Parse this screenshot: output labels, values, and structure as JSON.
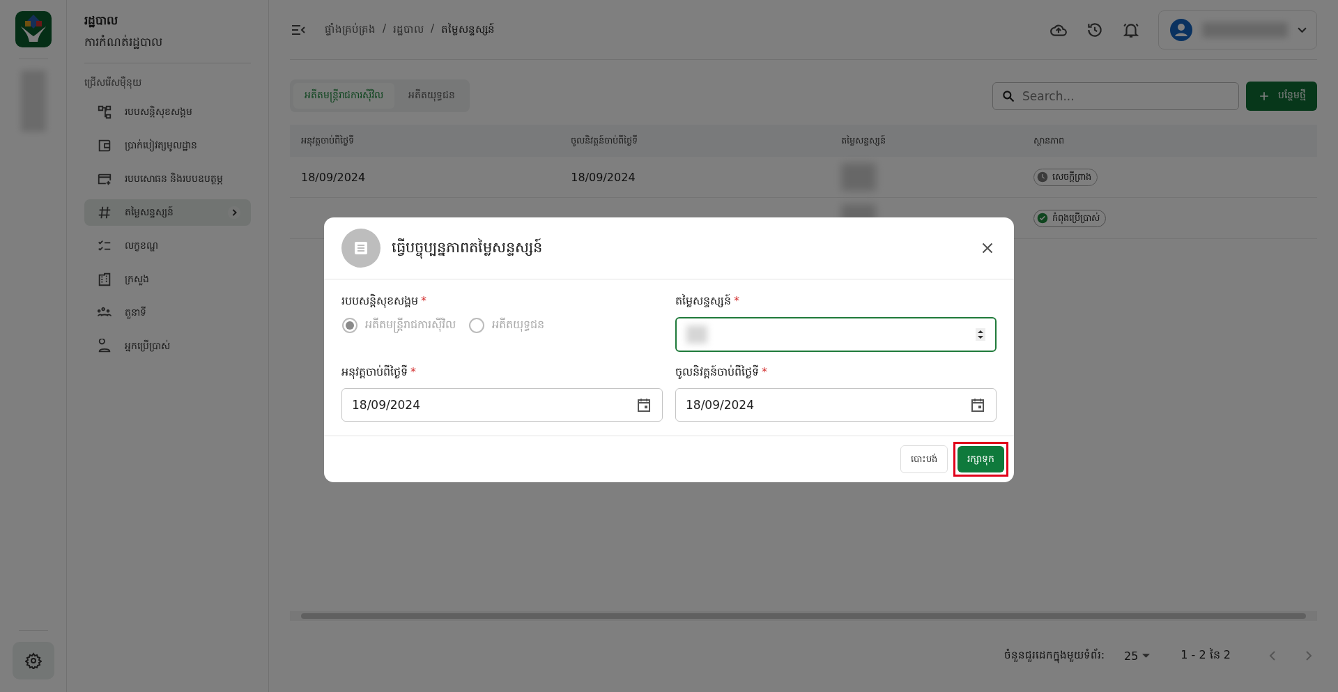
{
  "sidebar": {
    "title": "រដ្ឋបាល",
    "subtitle": "ការកំណត់រដ្ឋបាល",
    "section": "ជ្រើសរើសម៉ឺនុយ",
    "items": [
      {
        "label": "របបសន្តិសុខសង្គម",
        "selected": false
      },
      {
        "label": "ប្រាក់បៀវត្សមូលដ្ឋាន",
        "selected": false
      },
      {
        "label": "របបសោធន និងរបបឧបត្ថម្ភ",
        "selected": false
      },
      {
        "label": "តម្លៃសន្ទស្សន៍",
        "selected": true
      },
      {
        "label": "លក្ខខណ្ឌ",
        "selected": false
      },
      {
        "label": "ក្រសួង",
        "selected": false
      },
      {
        "label": "តួនាទី",
        "selected": false
      },
      {
        "label": "អ្នកប្រើប្រាស់",
        "selected": false
      }
    ]
  },
  "breadcrumb": [
    {
      "kind": "link",
      "text": "ផ្ទាំងគ្រប់គ្រង"
    },
    {
      "kind": "separator",
      "text": "/"
    },
    {
      "kind": "link",
      "text": "រដ្ឋបាល"
    },
    {
      "kind": "separator",
      "text": "/"
    },
    {
      "kind": "current",
      "text": "តម្លៃសន្ទស្សន៍"
    }
  ],
  "tabs": [
    {
      "label": "អតីតមន្ត្រីរាជការស៊ីវិល",
      "selected": true
    },
    {
      "label": "អតីតយុទ្ធជន",
      "selected": false
    }
  ],
  "search": {
    "placeholder": "Search..."
  },
  "add_button": "បន្ថែមថ្មី",
  "table": {
    "columns": [
      "អនុវត្តចាប់ពីថ្ងៃទី",
      "ចូលនិវត្តន៍ចាប់ពីថ្ងៃទី",
      "តម្លៃសន្ទស្សន៍",
      "ស្ថានភាព"
    ],
    "rows": [
      {
        "cells": [
          "18/09/2024",
          "18/09/2024"
        ],
        "status": {
          "label": "សេចក្តីព្រាង",
          "kind": "draft"
        }
      },
      {
        "cells": [],
        "status": {
          "label": "កំពុងប្រើប្រាស់",
          "kind": "active"
        }
      }
    ]
  },
  "pagination": {
    "rows_per_page_label": "ចំនួនជួរដេកក្នុងមួយទំព័រ:",
    "rows_per_page": "25",
    "range": "1 - 2 នៃ 2"
  },
  "dialog": {
    "title": "ធ្វើបច្ចុប្បន្នភាពតម្លៃសន្ទស្សន៍",
    "fields": [
      {
        "kind": "radio",
        "label": "របបសន្តិសុខសង្គម",
        "required_mark": "*",
        "disabled": true,
        "options": [
          {
            "label": "អតីតមន្ត្រីរាជការស៊ីវិល",
            "selected": true
          },
          {
            "label": "អតីតយុទ្ធជន",
            "selected": false
          }
        ]
      },
      {
        "kind": "number",
        "label": "តម្លៃសន្ទស្សន៍",
        "required_mark": "*",
        "focused": true
      },
      {
        "kind": "date",
        "label": "អនុវត្តចាប់ពីថ្ងៃទី",
        "required_mark": "*",
        "value": "18/09/2024",
        "focused": false
      },
      {
        "kind": "date",
        "label": "ចូលនិវត្តន៍ចាប់ពីថ្ងៃទី",
        "required_mark": "*",
        "value": "18/09/2024",
        "focused": false
      }
    ],
    "cancel": "បោះបង់",
    "save": {
      "label": "រក្សាទុក",
      "highlighted": true
    }
  }
}
